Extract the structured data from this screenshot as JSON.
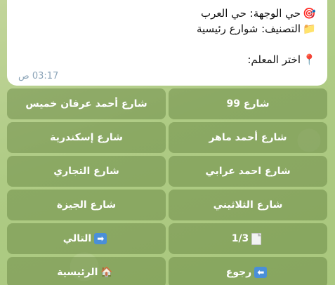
{
  "message": {
    "destination": {
      "emoji": "🎯",
      "text": "حي الوجهة: حي العرب"
    },
    "category": {
      "emoji": "📁",
      "text": "التصنيف: شوارع رئيسية"
    },
    "prompt": {
      "emoji": "📍",
      "text": "اختر المعلم:"
    },
    "time": "03:17 ص"
  },
  "keyboard": {
    "row1": {
      "right": "شارع أحمد عرفان خميس",
      "left": "شارع 99"
    },
    "row2": {
      "right": "شارع إسكندرية",
      "left": "شارع أحمد ماهر"
    },
    "row3": {
      "right": "شارع التجاري",
      "left": "شارع احمد عرابي"
    },
    "row4": {
      "right": "شارع الجيزة",
      "left": "شارع الثلاثيني"
    },
    "row5": {
      "right": "التالي",
      "right_icon": "➡",
      "left": "1/3",
      "left_icon": "page-icon"
    },
    "row6": {
      "right": "الرئيسية",
      "right_icon": "🏠",
      "left": "رجوع",
      "left_icon": "⬅"
    }
  }
}
